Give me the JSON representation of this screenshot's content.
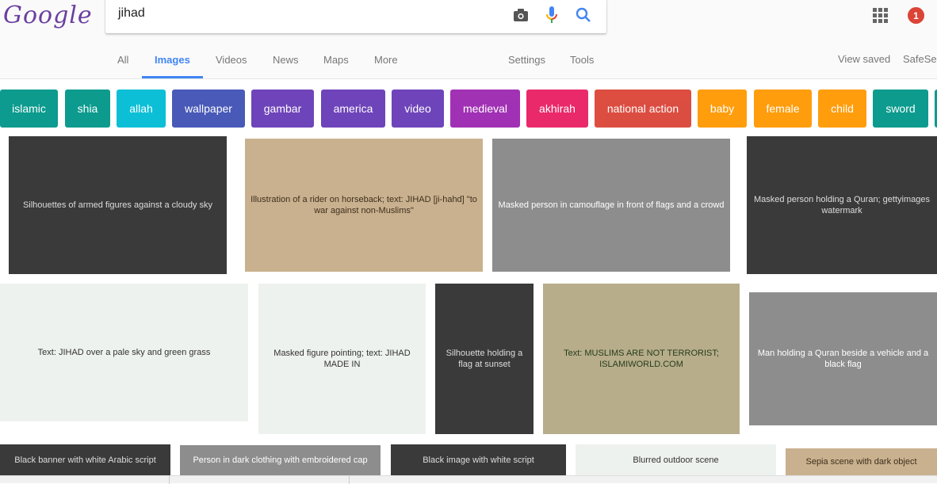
{
  "header": {
    "logo_text": "Google",
    "search_query": "jihad",
    "icons": {
      "camera": "camera-icon",
      "mic": "microphone-icon",
      "search": "search-icon",
      "apps": "apps-grid-icon"
    },
    "notification_count": "1"
  },
  "nav": {
    "tabs": [
      {
        "label": "All",
        "active": false
      },
      {
        "label": "Images",
        "active": true
      },
      {
        "label": "Videos",
        "active": false
      },
      {
        "label": "News",
        "active": false
      },
      {
        "label": "Maps",
        "active": false
      },
      {
        "label": "More",
        "active": false
      }
    ],
    "settings_label": "Settings",
    "tools_label": "Tools",
    "view_saved_label": "View saved",
    "safesearch_label": "SafeSe"
  },
  "related_chips": [
    {
      "label": "islamic",
      "color": "#009688"
    },
    {
      "label": "shia",
      "color": "#009688"
    },
    {
      "label": "allah",
      "color": "#00bcd4"
    },
    {
      "label": "wallpaper",
      "color": "#3f51b5"
    },
    {
      "label": "gambar",
      "color": "#673ab7"
    },
    {
      "label": "america",
      "color": "#673ab7"
    },
    {
      "label": "video",
      "color": "#673ab7"
    },
    {
      "label": "medieval",
      "color": "#9c27b0"
    },
    {
      "label": "akhirah",
      "color": "#e91e63"
    },
    {
      "label": "national action",
      "color": "#db4437"
    },
    {
      "label": "baby",
      "color": "#ff9800"
    },
    {
      "label": "female",
      "color": "#ff9800"
    },
    {
      "label": "child",
      "color": "#ff9800"
    },
    {
      "label": "sword",
      "color": "#009688"
    },
    {
      "label": "",
      "color": "#009688"
    }
  ],
  "results": [
    {
      "desc": "Silhouettes of armed figures against a cloudy sky"
    },
    {
      "desc": "Illustration of a rider on horseback; text: JIHAD [ji-hahd] \"to war against non-Muslims\""
    },
    {
      "desc": "Masked person in camouflage in front of flags and a crowd"
    },
    {
      "desc": "Masked person holding a Quran; gettyimages watermark"
    },
    {
      "desc": "Text: JIHAD over a pale sky and green grass"
    },
    {
      "desc": "Masked figure pointing; text: JIHAD MADE IN"
    },
    {
      "desc": "Silhouette holding a flag at sunset"
    },
    {
      "desc": "Text: MUSLIMS ARE NOT TERRORIST; ISLAMIWORLD.COM"
    },
    {
      "desc": "Man holding a Quran beside a vehicle and a black flag"
    },
    {
      "desc": "Black banner with white Arabic script"
    },
    {
      "desc": "Person in dark clothing with embroidered cap"
    },
    {
      "desc": "Black image with white script"
    },
    {
      "desc": "Blurred outdoor scene"
    },
    {
      "desc": "Sepia scene with dark object"
    }
  ]
}
